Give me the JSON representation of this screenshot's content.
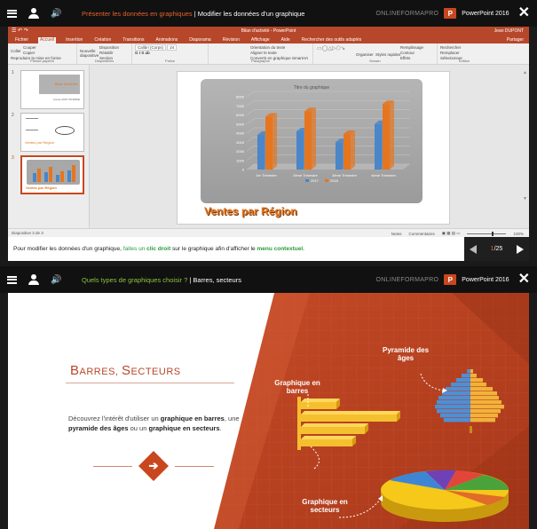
{
  "screen1": {
    "topbar": {
      "title_link": "Présenter les données en graphiques",
      "title_sep": " | ",
      "title_page": "Modifier les données d'un graphique",
      "brand": "ONLINEFORMAPRO",
      "app_name": "PowerPoint 2016",
      "app_badge": "P",
      "close": "✕"
    },
    "ppt": {
      "doc_title": "Bilan d'activité - PowerPoint",
      "user": "Jean DUPONT",
      "qat": "☰ ↶ ↷",
      "tabs": [
        "Fichier",
        "Accueil",
        "Insertion",
        "Création",
        "Transitions",
        "Animations",
        "Diaporama",
        "Révision",
        "Affichage",
        "Aide",
        "Rechercher des outils adaptés"
      ],
      "share": "Partager",
      "ribbon": {
        "clipboard": {
          "items": [
            "Couper",
            "Copier",
            "Reproduire la mise en forme"
          ],
          "paste": "Coller",
          "label": "Presse-papiers"
        },
        "slides": {
          "items": [
            "Disposition",
            "Rétablir",
            "Section"
          ],
          "new": "Nouvelle diapositive",
          "label": "Diapositives"
        },
        "font": {
          "name": "Calibri (Corps)",
          "size": "24",
          "label": "Police"
        },
        "paragraph": {
          "items": [
            "Orientation du texte",
            "Aligner le texte",
            "Convertir en graphique SmartArt"
          ],
          "label": "Paragraphe"
        },
        "drawing": {
          "items": [
            "Remplissage",
            "Contour",
            "Effets"
          ],
          "arrange": "Organiser",
          "styles": "Styles rapides",
          "label": "Dessin"
        },
        "editing": {
          "items": [
            "Rechercher",
            "Remplacer",
            "Sélectionner"
          ],
          "label": "Édition"
        }
      },
      "thumbnails": [
        {
          "num": "1",
          "caption": "Bilan d'activité",
          "date": "Année 2016 INTERNE"
        },
        {
          "num": "2",
          "caption": "Ventes par Région"
        },
        {
          "num": "3",
          "caption": "Ventes par Région"
        }
      ],
      "chart_data": {
        "type": "bar",
        "title": "Titre du graphique",
        "categories": [
          "1er Trimestre",
          "2ème Trimestre",
          "3ème Trimestre",
          "4ème Trimestre"
        ],
        "series": [
          {
            "name": "2017",
            "values": [
              3800,
              4200,
              3000,
              5000
            ]
          },
          {
            "name": "2018",
            "values": [
              5800,
              6400,
              3900,
              7200
            ]
          }
        ],
        "ylim": [
          0,
          8000
        ],
        "yticks": [
          "0",
          "1000",
          "2000",
          "3000",
          "4000",
          "5000",
          "6000",
          "7000",
          "8000"
        ],
        "legend_position": "bottom"
      },
      "colors": {
        "series1": "#4a86c8",
        "series2": "#e5761f",
        "accent": "#b7472a"
      },
      "wordart": "Ventes par Région",
      "status": {
        "slide_info": "Diapositive 3 de 3",
        "notes": "Notes",
        "comments": "Commentaires",
        "zoom": "100%"
      }
    },
    "caption": {
      "part1": "Pour modifier les données d'un graphique, ",
      "part2": "faites un ",
      "part3": "clic droit",
      "part4": " sur le graphique afin d'afficher le ",
      "part5": "menu contextuel",
      "part6": "."
    },
    "pager": {
      "current": "1",
      "total": "/25"
    }
  },
  "screen2": {
    "topbar": {
      "title_link": "Quels types de graphiques choisir ?",
      "title_sep": " | ",
      "title_page": "Barres, secteurs",
      "brand": "ONLINEFORMAPRO",
      "app_name": "PowerPoint 2016",
      "app_badge": "P",
      "close": "✕"
    },
    "title_big1": "B",
    "title_small1": "ARRES, ",
    "title_big2": "S",
    "title_small2": "ECTEURS",
    "desc": {
      "part1": "Découvrez l'intérêt d'utiliser un ",
      "part2": "graphique en barres",
      "part3": ", une ",
      "part4": "pyramide des âges",
      "part5": " ou un ",
      "part6": "graphique en secteurs",
      "part7": "."
    },
    "labels": {
      "bars": "Graphique en barres",
      "pyramid": "Pyramide des âges",
      "pie": "Graphique en secteurs"
    },
    "colors": {
      "brand": "#c9471f",
      "bg_dark": "#b8401f",
      "bar": "#f5c030",
      "pyramid_left": "#4e8fd6",
      "pyramid_right": "#f2b23a"
    }
  }
}
